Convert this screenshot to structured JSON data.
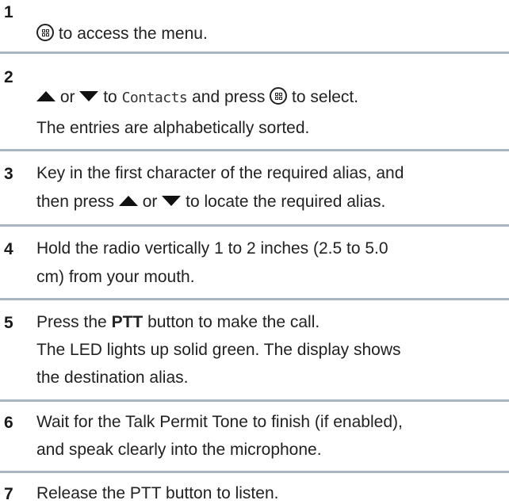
{
  "steps": [
    {
      "number": "1",
      "text_a": "to access the menu."
    },
    {
      "number": "2",
      "text_a": "or",
      "text_b": "to",
      "menu_item": "Contacts",
      "text_c": "and press",
      "text_d": "to select.",
      "note": "The entries are alphabetically sorted."
    },
    {
      "number": "3",
      "line1": "Key in the first character of the required alias, and",
      "line2_a": "then press",
      "line2_b": "or",
      "line2_c": "to locate the required alias."
    },
    {
      "number": "4",
      "line1": "Hold the radio vertically 1 to 2 inches (2.5 to 5.0",
      "line2": "cm) from your mouth."
    },
    {
      "number": "5",
      "line1_a": "Press the",
      "line1_bold": "PTT",
      "line1_b": "button to make the call.",
      "line2": "The LED lights up solid green. The display shows",
      "line3": "the destination alias."
    },
    {
      "number": "6",
      "line1": "Wait for the Talk Permit Tone to finish (if enabled),",
      "line2": "and speak clearly into the microphone."
    },
    {
      "number": "7",
      "line1": "Release the PTT button to listen."
    }
  ],
  "icons": {
    "menu_button": "menu-ok-button-icon",
    "up": "up-arrow-icon",
    "down": "down-arrow-icon"
  },
  "colors": {
    "separator": "#a9b5c0",
    "text": "#222222"
  }
}
